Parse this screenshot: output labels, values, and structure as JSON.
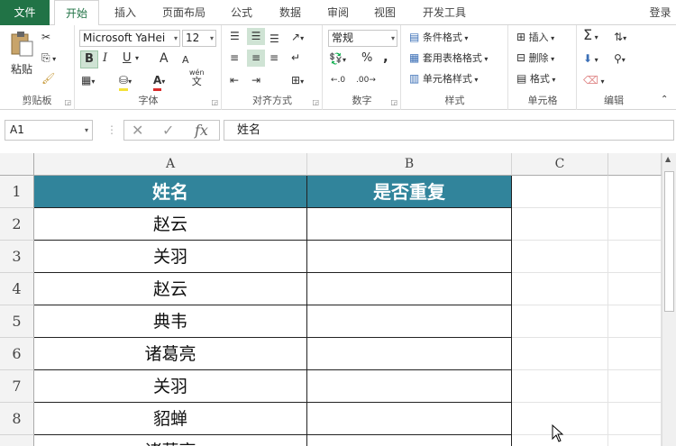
{
  "tabs": {
    "file": "文件",
    "home": "开始",
    "insert": "插入",
    "layout": "页面布局",
    "formulas": "公式",
    "data": "数据",
    "review": "审阅",
    "view": "视图",
    "developer": "开发工具",
    "login": "登录"
  },
  "ribbon": {
    "clipboard": {
      "label": "剪贴板",
      "paste": "粘贴"
    },
    "font": {
      "label": "字体",
      "name": "Microsoft YaHei",
      "size": "12",
      "bold": "B",
      "italic": "I",
      "underline": "U",
      "grow": "A",
      "shrink": "A",
      "wen": "wén",
      "wen_char": "文"
    },
    "alignment": {
      "label": "对齐方式"
    },
    "number": {
      "label": "数字",
      "format": "常规",
      "percent": "%",
      "comma": ","
    },
    "styles": {
      "label": "样式",
      "conditional": "条件格式",
      "table": "套用表格格式",
      "cell": "单元格样式"
    },
    "cells": {
      "label": "单元格",
      "insert": "插入",
      "delete": "删除",
      "format": "格式"
    },
    "editing": {
      "label": "编辑"
    }
  },
  "formula_bar": {
    "name_box": "A1",
    "formula": "姓名"
  },
  "sheet": {
    "columns": [
      "A",
      "B",
      "C"
    ],
    "rows": [
      "1",
      "2",
      "3",
      "4",
      "5",
      "6",
      "7",
      "8"
    ],
    "header": [
      "姓名",
      "是否重复"
    ],
    "names": [
      "赵云",
      "关羽",
      "赵云",
      "典韦",
      "诸葛亮",
      "关羽",
      "貂蝉",
      "诸葛亮"
    ]
  },
  "colors": {
    "file_tab": "#217346",
    "header_fill": "#31849b"
  }
}
